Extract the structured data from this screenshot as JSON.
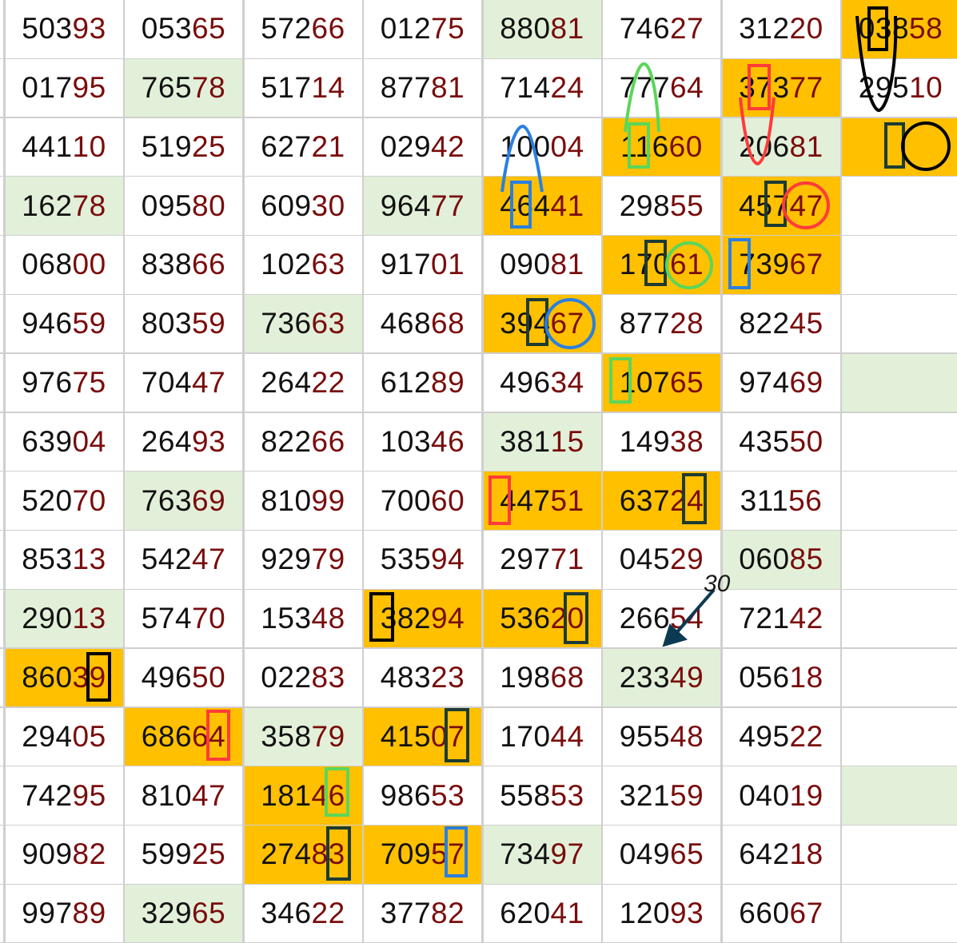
{
  "colors": {
    "green_fill": "#e2f0d9",
    "orange_fill": "#ffc000",
    "prefix_text": "#111111",
    "suffix_text": "#7a0c0c",
    "mark_black": "#000000",
    "mark_red": "#ff3b3b",
    "mark_green": "#5bd65b",
    "mark_blue": "#2a7fe0",
    "mark_darkgreen": "#1d3b33",
    "arrow": "#0b3a52"
  },
  "annotation_label": "30",
  "rows": [
    [
      {
        "p": "503",
        "s": "93",
        "f": ""
      },
      {
        "p": "053",
        "s": "65",
        "f": ""
      },
      {
        "p": "572",
        "s": "66",
        "f": ""
      },
      {
        "p": "012",
        "s": "75",
        "f": ""
      },
      {
        "p": "880",
        "s": "81",
        "f": "g"
      },
      {
        "p": "746",
        "s": "27",
        "f": ""
      },
      {
        "p": "312",
        "s": "20",
        "f": ""
      },
      {
        "p": "038",
        "s": "58",
        "f": "o"
      }
    ],
    [
      {
        "p": "017",
        "s": "95",
        "f": ""
      },
      {
        "p": "765",
        "s": "78",
        "f": "g"
      },
      {
        "p": "517",
        "s": "14",
        "f": ""
      },
      {
        "p": "877",
        "s": "81",
        "f": ""
      },
      {
        "p": "714",
        "s": "24",
        "f": ""
      },
      {
        "p": "777",
        "s": "64",
        "f": ""
      },
      {
        "p": "373",
        "s": "77",
        "f": "o"
      },
      {
        "p": "295",
        "s": "10",
        "f": ""
      }
    ],
    [
      {
        "p": "441",
        "s": "10",
        "f": ""
      },
      {
        "p": "519",
        "s": "25",
        "f": ""
      },
      {
        "p": "627",
        "s": "21",
        "f": ""
      },
      {
        "p": "029",
        "s": "42",
        "f": ""
      },
      {
        "p": "100",
        "s": "04",
        "f": ""
      },
      {
        "p": "116",
        "s": "60",
        "f": "o"
      },
      {
        "p": "206",
        "s": "81",
        "f": "g"
      },
      {
        "p": "",
        "s": "",
        "f": "o"
      }
    ],
    [
      {
        "p": "162",
        "s": "78",
        "f": "g"
      },
      {
        "p": "095",
        "s": "80",
        "f": ""
      },
      {
        "p": "609",
        "s": "30",
        "f": ""
      },
      {
        "p": "964",
        "s": "77",
        "f": "g"
      },
      {
        "p": "464",
        "s": "41",
        "f": "o"
      },
      {
        "p": "298",
        "s": "55",
        "f": ""
      },
      {
        "p": "457",
        "s": "47",
        "f": "o"
      },
      {
        "p": "",
        "s": "",
        "f": ""
      }
    ],
    [
      {
        "p": "068",
        "s": "00",
        "f": ""
      },
      {
        "p": "838",
        "s": "66",
        "f": ""
      },
      {
        "p": "102",
        "s": "63",
        "f": ""
      },
      {
        "p": "917",
        "s": "01",
        "f": ""
      },
      {
        "p": "090",
        "s": "81",
        "f": ""
      },
      {
        "p": "170",
        "s": "61",
        "f": "o"
      },
      {
        "p": "739",
        "s": "67",
        "f": "o"
      },
      {
        "p": "",
        "s": "",
        "f": ""
      }
    ],
    [
      {
        "p": "946",
        "s": "59",
        "f": ""
      },
      {
        "p": "803",
        "s": "59",
        "f": ""
      },
      {
        "p": "736",
        "s": "63",
        "f": "g"
      },
      {
        "p": "468",
        "s": "68",
        "f": ""
      },
      {
        "p": "394",
        "s": "67",
        "f": "o"
      },
      {
        "p": "877",
        "s": "28",
        "f": ""
      },
      {
        "p": "822",
        "s": "45",
        "f": ""
      },
      {
        "p": "",
        "s": "",
        "f": ""
      }
    ],
    [
      {
        "p": "976",
        "s": "75",
        "f": ""
      },
      {
        "p": "704",
        "s": "47",
        "f": ""
      },
      {
        "p": "264",
        "s": "22",
        "f": ""
      },
      {
        "p": "612",
        "s": "89",
        "f": ""
      },
      {
        "p": "496",
        "s": "34",
        "f": ""
      },
      {
        "p": "107",
        "s": "65",
        "f": "o"
      },
      {
        "p": "974",
        "s": "69",
        "f": ""
      },
      {
        "p": "",
        "s": "",
        "f": "g"
      }
    ],
    [
      {
        "p": "639",
        "s": "04",
        "f": ""
      },
      {
        "p": "264",
        "s": "93",
        "f": ""
      },
      {
        "p": "822",
        "s": "66",
        "f": ""
      },
      {
        "p": "103",
        "s": "46",
        "f": ""
      },
      {
        "p": "381",
        "s": "15",
        "f": "g"
      },
      {
        "p": "149",
        "s": "38",
        "f": ""
      },
      {
        "p": "435",
        "s": "50",
        "f": ""
      },
      {
        "p": "",
        "s": "",
        "f": ""
      }
    ],
    [
      {
        "p": "520",
        "s": "70",
        "f": ""
      },
      {
        "p": "763",
        "s": "69",
        "f": "g"
      },
      {
        "p": "810",
        "s": "99",
        "f": ""
      },
      {
        "p": "700",
        "s": "60",
        "f": ""
      },
      {
        "p": "447",
        "s": "51",
        "f": "o"
      },
      {
        "p": "637",
        "s": "24",
        "f": "o"
      },
      {
        "p": "311",
        "s": "56",
        "f": ""
      },
      {
        "p": "",
        "s": "",
        "f": ""
      }
    ],
    [
      {
        "p": "853",
        "s": "13",
        "f": ""
      },
      {
        "p": "542",
        "s": "47",
        "f": ""
      },
      {
        "p": "929",
        "s": "79",
        "f": ""
      },
      {
        "p": "535",
        "s": "94",
        "f": ""
      },
      {
        "p": "297",
        "s": "71",
        "f": ""
      },
      {
        "p": "045",
        "s": "29",
        "f": ""
      },
      {
        "p": "060",
        "s": "85",
        "f": "g"
      },
      {
        "p": "",
        "s": "",
        "f": ""
      }
    ],
    [
      {
        "p": "290",
        "s": "13",
        "f": "g"
      },
      {
        "p": "574",
        "s": "70",
        "f": ""
      },
      {
        "p": "153",
        "s": "48",
        "f": ""
      },
      {
        "p": "382",
        "s": "94",
        "f": "o"
      },
      {
        "p": "536",
        "s": "20",
        "f": "o"
      },
      {
        "p": "266",
        "s": "54",
        "f": ""
      },
      {
        "p": "721",
        "s": "42",
        "f": ""
      },
      {
        "p": "",
        "s": "",
        "f": ""
      }
    ],
    [
      {
        "p": "860",
        "s": "39",
        "f": "o"
      },
      {
        "p": "496",
        "s": "50",
        "f": ""
      },
      {
        "p": "022",
        "s": "83",
        "f": ""
      },
      {
        "p": "483",
        "s": "23",
        "f": ""
      },
      {
        "p": "198",
        "s": "68",
        "f": ""
      },
      {
        "p": "233",
        "s": "49",
        "f": "g"
      },
      {
        "p": "056",
        "s": "18",
        "f": ""
      },
      {
        "p": "",
        "s": "",
        "f": ""
      }
    ],
    [
      {
        "p": "294",
        "s": "05",
        "f": ""
      },
      {
        "p": "686",
        "s": "64",
        "f": "o"
      },
      {
        "p": "358",
        "s": "79",
        "f": "g"
      },
      {
        "p": "415",
        "s": "07",
        "f": "o"
      },
      {
        "p": "170",
        "s": "44",
        "f": ""
      },
      {
        "p": "955",
        "s": "48",
        "f": ""
      },
      {
        "p": "495",
        "s": "22",
        "f": ""
      },
      {
        "p": "",
        "s": "",
        "f": ""
      }
    ],
    [
      {
        "p": "742",
        "s": "95",
        "f": ""
      },
      {
        "p": "810",
        "s": "47",
        "f": ""
      },
      {
        "p": "181",
        "s": "46",
        "f": "o"
      },
      {
        "p": "986",
        "s": "53",
        "f": ""
      },
      {
        "p": "558",
        "s": "53",
        "f": ""
      },
      {
        "p": "321",
        "s": "59",
        "f": ""
      },
      {
        "p": "040",
        "s": "19",
        "f": ""
      },
      {
        "p": "",
        "s": "",
        "f": "g"
      }
    ],
    [
      {
        "p": "909",
        "s": "82",
        "f": ""
      },
      {
        "p": "599",
        "s": "25",
        "f": ""
      },
      {
        "p": "274",
        "s": "83",
        "f": "o"
      },
      {
        "p": "709",
        "s": "57",
        "f": "o"
      },
      {
        "p": "734",
        "s": "97",
        "f": "g"
      },
      {
        "p": "049",
        "s": "65",
        "f": ""
      },
      {
        "p": "642",
        "s": "18",
        "f": ""
      },
      {
        "p": "",
        "s": "",
        "f": ""
      }
    ],
    [
      {
        "p": "997",
        "s": "89",
        "f": ""
      },
      {
        "p": "329",
        "s": "65",
        "f": "g"
      },
      {
        "p": "346",
        "s": "22",
        "f": ""
      },
      {
        "p": "377",
        "s": "82",
        "f": ""
      },
      {
        "p": "620",
        "s": "41",
        "f": ""
      },
      {
        "p": "120",
        "s": "93",
        "f": ""
      },
      {
        "p": "660",
        "s": "67",
        "f": ""
      },
      {
        "p": "",
        "s": "",
        "f": ""
      }
    ]
  ]
}
